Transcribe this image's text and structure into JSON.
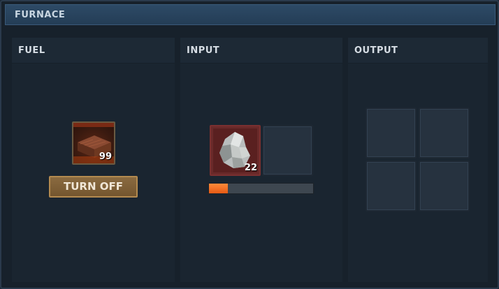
{
  "window": {
    "title": "FURNACE"
  },
  "fuel": {
    "header": "FUEL",
    "slot": {
      "item": "wood-log-icon",
      "count": "99"
    },
    "toggle_label": "TURN OFF"
  },
  "input": {
    "header": "INPUT",
    "slots": [
      {
        "item": "metal-ore-icon",
        "count": "22"
      },
      {
        "item": "",
        "count": ""
      }
    ],
    "progress": 0.18
  },
  "output": {
    "header": "OUTPUT",
    "slots": [
      {
        "item": "",
        "count": ""
      },
      {
        "item": "",
        "count": ""
      },
      {
        "item": "",
        "count": ""
      },
      {
        "item": "",
        "count": ""
      }
    ]
  },
  "colors": {
    "progress_fill": "#f26b21",
    "button": "#7d5f36",
    "background": "#17212b"
  }
}
